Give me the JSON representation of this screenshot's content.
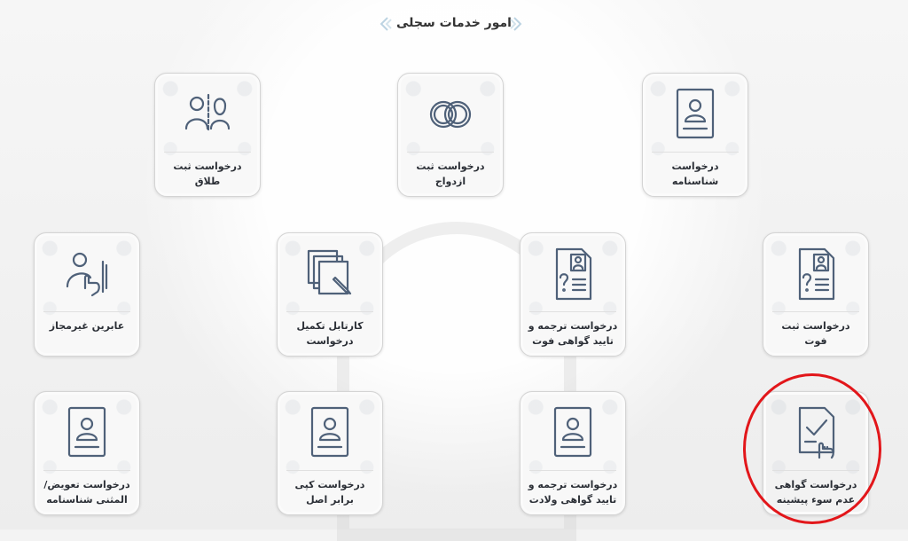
{
  "header": {
    "title": "امور خدمات سجلی"
  },
  "cards": [
    {
      "label": "درخواست ثبت طلاق",
      "icon": "couple-divorce-icon"
    },
    {
      "label": "درخواست ثبت ازدواج",
      "icon": "wedding-rings-icon"
    },
    {
      "label": "درخواست شناسنامه",
      "icon": "id-card-icon"
    },
    {
      "label": "عابرین غیرمجاز",
      "icon": "hand-touch-person-icon"
    },
    {
      "label": "کارتابل تکمیل درخواست",
      "icon": "documents-edit-icon"
    },
    {
      "label": "درخواست ترجمه و تایید گواهی فوت",
      "icon": "document-question-icon"
    },
    {
      "label": "درخواست ثبت فوت",
      "icon": "document-question-icon"
    },
    {
      "label": "درخواست تعویض/ المثنی شناسنامه",
      "icon": "id-card-icon"
    },
    {
      "label": "درخواست کپی برابر اصل",
      "icon": "id-card-icon"
    },
    {
      "label": "درخواست ترجمه و تایید گواهی ولادت",
      "icon": "id-card-icon"
    },
    {
      "label": "درخواست گواهی عدم سوء پیشینه",
      "icon": "document-check-touch-icon"
    }
  ],
  "colors": {
    "icon_stroke": "#4f6179",
    "highlight_circle": "#e2161a"
  }
}
